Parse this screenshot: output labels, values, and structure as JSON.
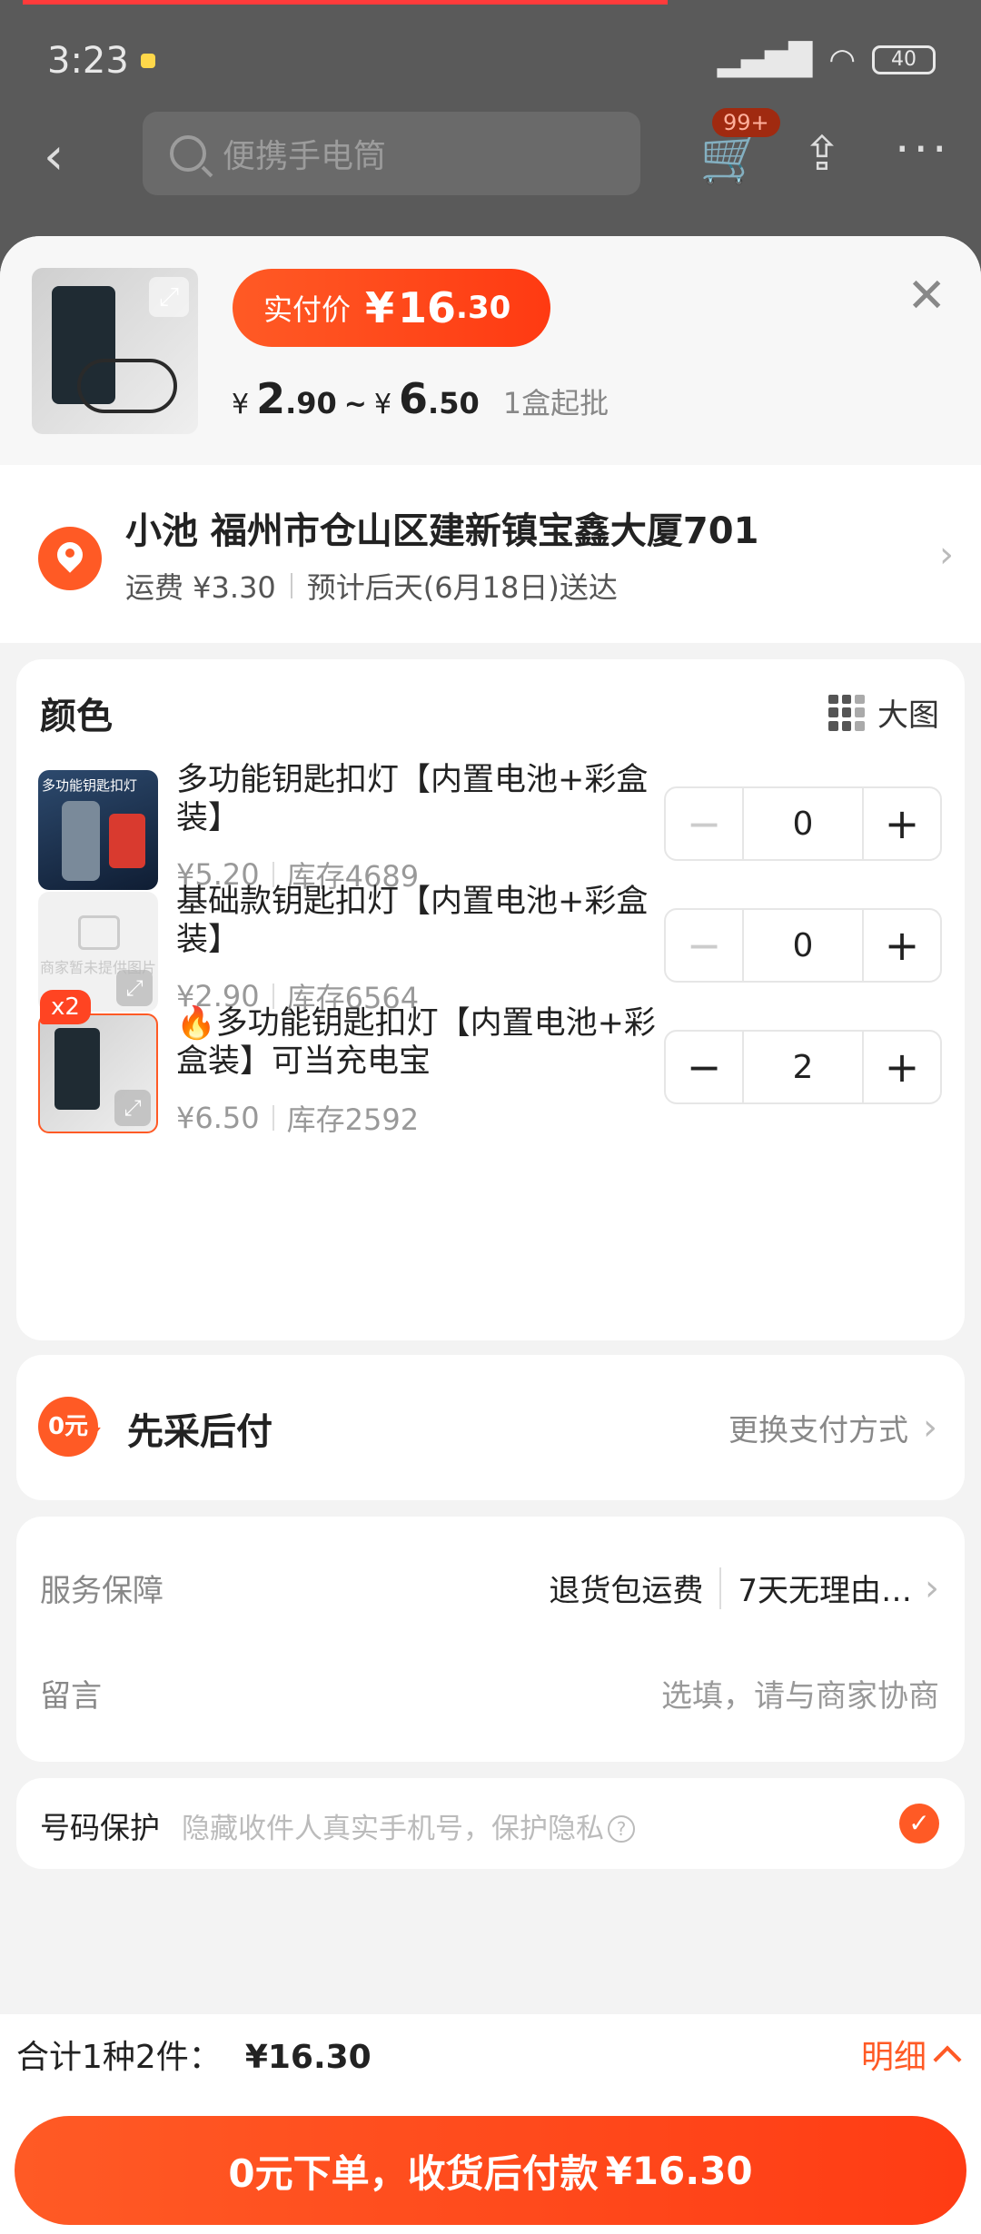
{
  "status_bar": {
    "time": "3:23",
    "network": "HD",
    "battery": "40"
  },
  "nav": {
    "search_placeholder": "便携手电筒",
    "cart_badge": "99+"
  },
  "product": {
    "real_price_label": "实付价",
    "real_price_currency": "¥",
    "real_price_int": "16",
    "real_price_dec": ".30",
    "range_currency": "¥",
    "range_low_int": "2",
    "range_low_dec": ".90",
    "range_sep": "~",
    "range_high_int": "6",
    "range_high_dec": ".50",
    "min_order": "1盒起批"
  },
  "address": {
    "line": "小池 福州市仓山区建新镇宝鑫大厦701",
    "shipping": "运费 ¥3.30",
    "delivery": "预计后天(6月18日)送达"
  },
  "color_section": {
    "title": "颜色",
    "big_pic_label": "大图",
    "items": [
      {
        "name": "多功能钥匙扣灯【内置电池+彩盒装】",
        "price": "¥5.20",
        "stock": "库存4689",
        "qty": "0",
        "img_text": "多功能钥匙扣灯"
      },
      {
        "name": "基础款钥匙扣灯【内置电池+彩盒装】",
        "price": "¥2.90",
        "stock": "库存6564",
        "qty": "0",
        "img_text": "商家暂未提供图片"
      },
      {
        "name": "🔥多功能钥匙扣灯【内置电池+彩盒装】可当充电宝",
        "price": "¥6.50",
        "stock": "库存2592",
        "qty": "2",
        "badge": "x2"
      }
    ]
  },
  "payment": {
    "title": "先采后付",
    "change_label": "更换支付方式",
    "icon_text": "0元"
  },
  "service": {
    "label": "服务保障",
    "value1": "退货包运费",
    "value2": "7天无理由…",
    "note_label": "留言",
    "note_placeholder": "选填，请与商家协商"
  },
  "privacy": {
    "label": "号码保护",
    "text": "隐藏收件人真实手机号，保护隐私"
  },
  "footer": {
    "total_label": "合计1种2件：",
    "total_amount": "¥16.30",
    "detail_label": "明细",
    "submit_label": "0元下单，收货后付款",
    "submit_amount": "¥16.30"
  },
  "colors": {
    "accent": "#ff5a25",
    "overlay": "#5a5a5a"
  }
}
